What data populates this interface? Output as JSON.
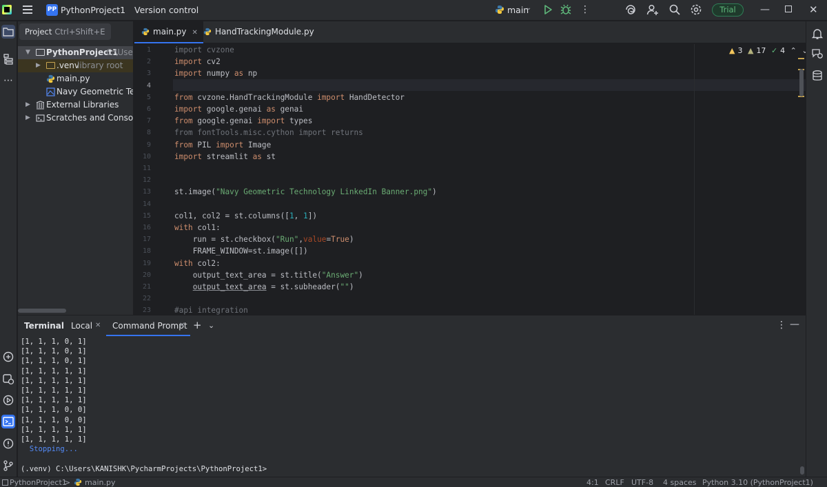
{
  "titlebar": {
    "project_badge": "PP",
    "project_name": "PythonProject1",
    "version_control": "Version control",
    "run_config": "main",
    "trial": "Trial"
  },
  "project_panel": {
    "header": "Project",
    "header_shortcut": "Ctrl+Shift+E",
    "tree": [
      {
        "label": "PythonProject1",
        "suffix": "C:\\Users"
      },
      {
        "label": ".venv",
        "suffix": "library root"
      },
      {
        "label": "main.py"
      },
      {
        "label": "Navy Geometric Technology LinkedIn Banner.png"
      },
      {
        "label": "External Libraries"
      },
      {
        "label": "Scratches and Consoles"
      }
    ]
  },
  "editor": {
    "tabs": [
      {
        "label": "main.py"
      },
      {
        "label": "HandTrackingModule.py"
      }
    ],
    "inspections": {
      "warnings": "3",
      "weak_warnings": "17",
      "ok": "4"
    },
    "line_numbers": [
      "1",
      "2",
      "3",
      "4",
      "5",
      "6",
      "7",
      "8",
      "9",
      "10",
      "11",
      "12",
      "13",
      "14",
      "15",
      "16",
      "17",
      "18",
      "19",
      "20",
      "21",
      "22",
      "23"
    ],
    "current_line": 4,
    "code": [
      "import cvzone",
      "import cv2",
      "import numpy as np",
      "",
      "from cvzone.HandTrackingModule import HandDetector",
      "import google.genai as genai",
      "from google.genai import types",
      "from fontTools.misc.cython import returns",
      "from PIL import Image",
      "import streamlit as st",
      "",
      "",
      "st.image(\"Navy Geometric Technology LinkedIn Banner.png\")",
      "",
      "col1, col2 = st.columns([1, 1])",
      "with col1:",
      "    run = st.checkbox(\"Run\",value=True)",
      "    FRAME_WINDOW=st.image([])",
      "with col2:",
      "    output_text_area = st.title(\"Answer\")",
      "    output_text_area = st.subheader(\"\")",
      "",
      "#api integration"
    ]
  },
  "terminal": {
    "tabs": {
      "terminal": "Terminal",
      "local": "Local",
      "command_prompt": "Command Prompt"
    },
    "lines": [
      "[1, 1, 1, 0, 1]",
      "[1, 1, 1, 0, 1]",
      "[1, 1, 1, 0, 1]",
      "[1, 1, 1, 1, 1]",
      "[1, 1, 1, 1, 1]",
      "[1, 1, 1, 1, 1]",
      "[1, 1, 1, 1, 1]",
      "[1, 1, 1, 0, 0]",
      "[1, 1, 1, 0, 0]",
      "[1, 1, 1, 1, 1]",
      "[1, 1, 1, 1, 1]"
    ],
    "stopping": "  Stopping...",
    "prompt": "(.venv) C:\\Users\\KANISHK\\PycharmProjects\\PythonProject1>"
  },
  "statusbar": {
    "breadcrumb_project": "PythonProject1",
    "breadcrumb_sep": ">",
    "breadcrumb_file": "main.py",
    "position": "4:1",
    "line_sep": "CRLF",
    "encoding": "UTF-8",
    "indent": "4 spaces",
    "interpreter": "Python 3.10 (PythonProject1)"
  },
  "colors": {
    "accent": "#3574f0",
    "keyword": "#cf8e6d",
    "string": "#6aab73",
    "number": "#2aacb8",
    "trial": "#5fb97b"
  }
}
